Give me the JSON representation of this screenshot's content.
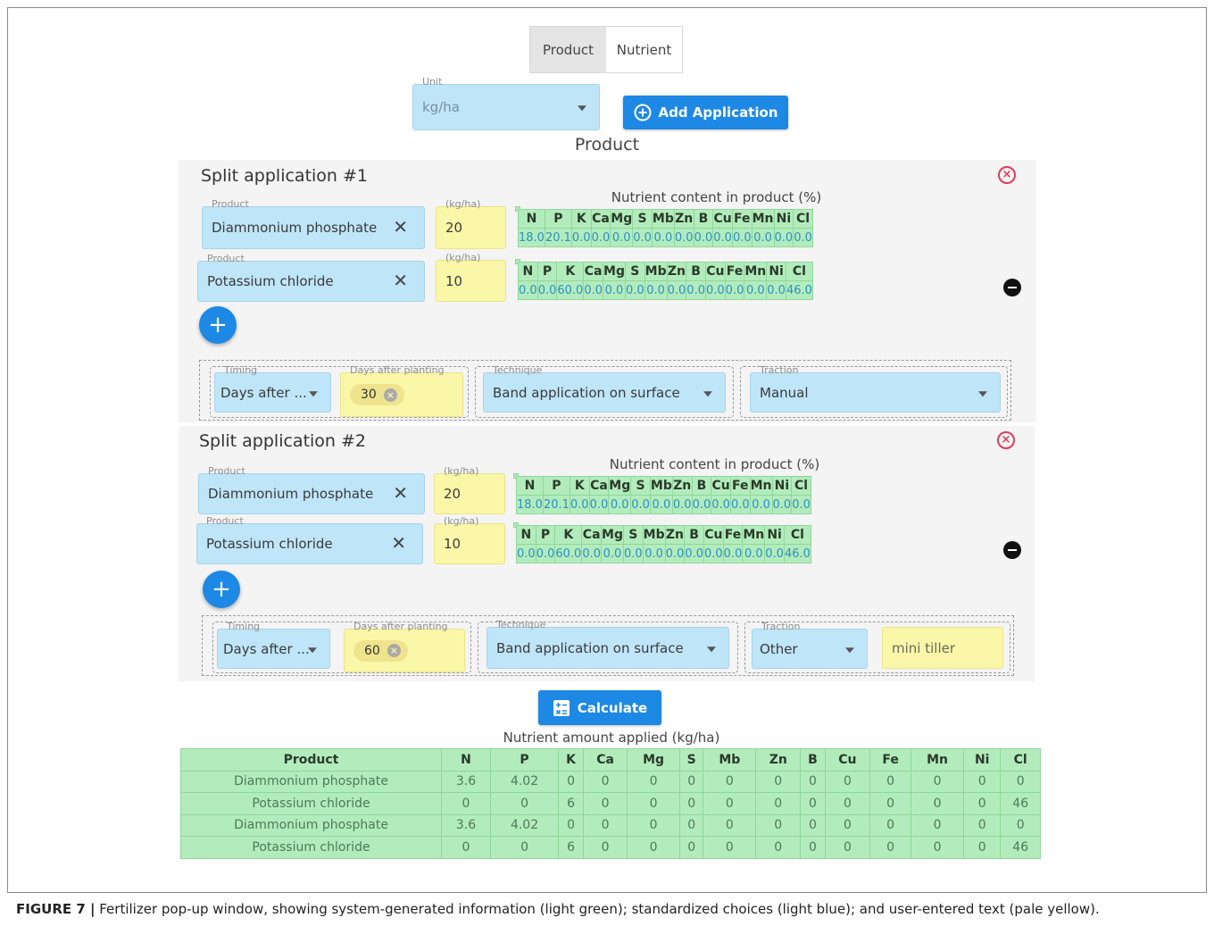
{
  "toggle": {
    "product_label": "Product",
    "nutrient_label": "Nutrient"
  },
  "unit": {
    "label": "Unit",
    "value": "kg/ha"
  },
  "add_application": {
    "label": "Add Application"
  },
  "section_title": "Product",
  "nutrient_header": [
    "N",
    "P",
    "K",
    "Ca",
    "Mg",
    "S",
    "Mb",
    "Zn",
    "B",
    "Cu",
    "Fe",
    "Mn",
    "Ni",
    "Cl"
  ],
  "applications": [
    {
      "title": "Split application #1",
      "nutrient_caption": "Nutrient content in product (%)",
      "products": [
        {
          "label": "Product",
          "name": "Diammonium phosphate",
          "rate_label": "(kg/ha)",
          "rate": "20",
          "content": [
            "18.0",
            "20.1",
            "0.0",
            "0.0",
            "0.0",
            "0.0",
            "0.0",
            "0.0",
            "0.0",
            "0.0",
            "0.0",
            "0.0",
            "0.0",
            "0.0"
          ]
        },
        {
          "label": "Product",
          "name": "Potassium chloride",
          "rate_label": "(kg/ha)",
          "rate": "10",
          "content": [
            "0.0",
            "0.0",
            "60.0",
            "0.0",
            "0.0",
            "0.0",
            "0.0",
            "0.0",
            "0.0",
            "0.0",
            "0.0",
            "0.0",
            "0.0",
            "46.0"
          ]
        }
      ],
      "timing": {
        "label": "Timing",
        "value": "Days after ..."
      },
      "days": {
        "label": "Days after planting",
        "value": "30"
      },
      "technique": {
        "label": "Technique",
        "value": "Band application on surface"
      },
      "traction": {
        "label": "Traction",
        "value": "Manual"
      }
    },
    {
      "title": "Split application #2",
      "nutrient_caption": "Nutrient content in product (%)",
      "products": [
        {
          "label": "Product",
          "name": "Diammonium phosphate",
          "rate_label": "(kg/ha)",
          "rate": "20",
          "content": [
            "18.0",
            "20.1",
            "0.0",
            "0.0",
            "0.0",
            "0.0",
            "0.0",
            "0.0",
            "0.0",
            "0.0",
            "0.0",
            "0.0",
            "0.0",
            "0.0"
          ]
        },
        {
          "label": "Product",
          "name": "Potassium chloride",
          "rate_label": "(kg/ha)",
          "rate": "10",
          "content": [
            "0.0",
            "0.0",
            "60.0",
            "0.0",
            "0.0",
            "0.0",
            "0.0",
            "0.0",
            "0.0",
            "0.0",
            "0.0",
            "0.0",
            "0.0",
            "46.0"
          ]
        }
      ],
      "timing": {
        "label": "Timing",
        "value": "Days after ..."
      },
      "days": {
        "label": "Days after planting",
        "value": "60"
      },
      "technique": {
        "label": "Technique",
        "value": "Band application on surface"
      },
      "traction": {
        "label": "Traction",
        "value": "Other"
      },
      "traction_other": "mini tiller"
    }
  ],
  "calculate": {
    "label": "Calculate"
  },
  "results": {
    "caption": "Nutrient amount applied (kg/ha)",
    "columns": [
      "Product",
      "N",
      "P",
      "K",
      "Ca",
      "Mg",
      "S",
      "Mb",
      "Zn",
      "B",
      "Cu",
      "Fe",
      "Mn",
      "Ni",
      "Cl"
    ],
    "rows": [
      [
        "Diammonium phosphate",
        "3.6",
        "4.02",
        "0",
        "0",
        "0",
        "0",
        "0",
        "0",
        "0",
        "0",
        "0",
        "0",
        "0",
        "0"
      ],
      [
        "Potassium chloride",
        "0",
        "0",
        "6",
        "0",
        "0",
        "0",
        "0",
        "0",
        "0",
        "0",
        "0",
        "0",
        "0",
        "46"
      ],
      [
        "Diammonium phosphate",
        "3.6",
        "4.02",
        "0",
        "0",
        "0",
        "0",
        "0",
        "0",
        "0",
        "0",
        "0",
        "0",
        "0",
        "0"
      ],
      [
        "Potassium chloride",
        "0",
        "0",
        "6",
        "0",
        "0",
        "0",
        "0",
        "0",
        "0",
        "0",
        "0",
        "0",
        "0",
        "46"
      ]
    ]
  },
  "figure_caption": {
    "label": "FIGURE 7 |",
    "text": " Fertilizer pop-up window, showing system-generated information (light green); standardized choices (light blue); and user-entered text (pale yellow)."
  },
  "colors": {
    "green": "#b3ecbc",
    "blue": "#bfe5f8",
    "yellow": "#fbf7a8",
    "button": "#1e88e5",
    "remove": "#e23a5e"
  },
  "icons": {
    "add": "plus-circle-icon",
    "remove_split": "close-circle-icon",
    "remove_product": "minus-circle-icon",
    "calculate": "calculator-icon",
    "clear": "close-icon"
  }
}
